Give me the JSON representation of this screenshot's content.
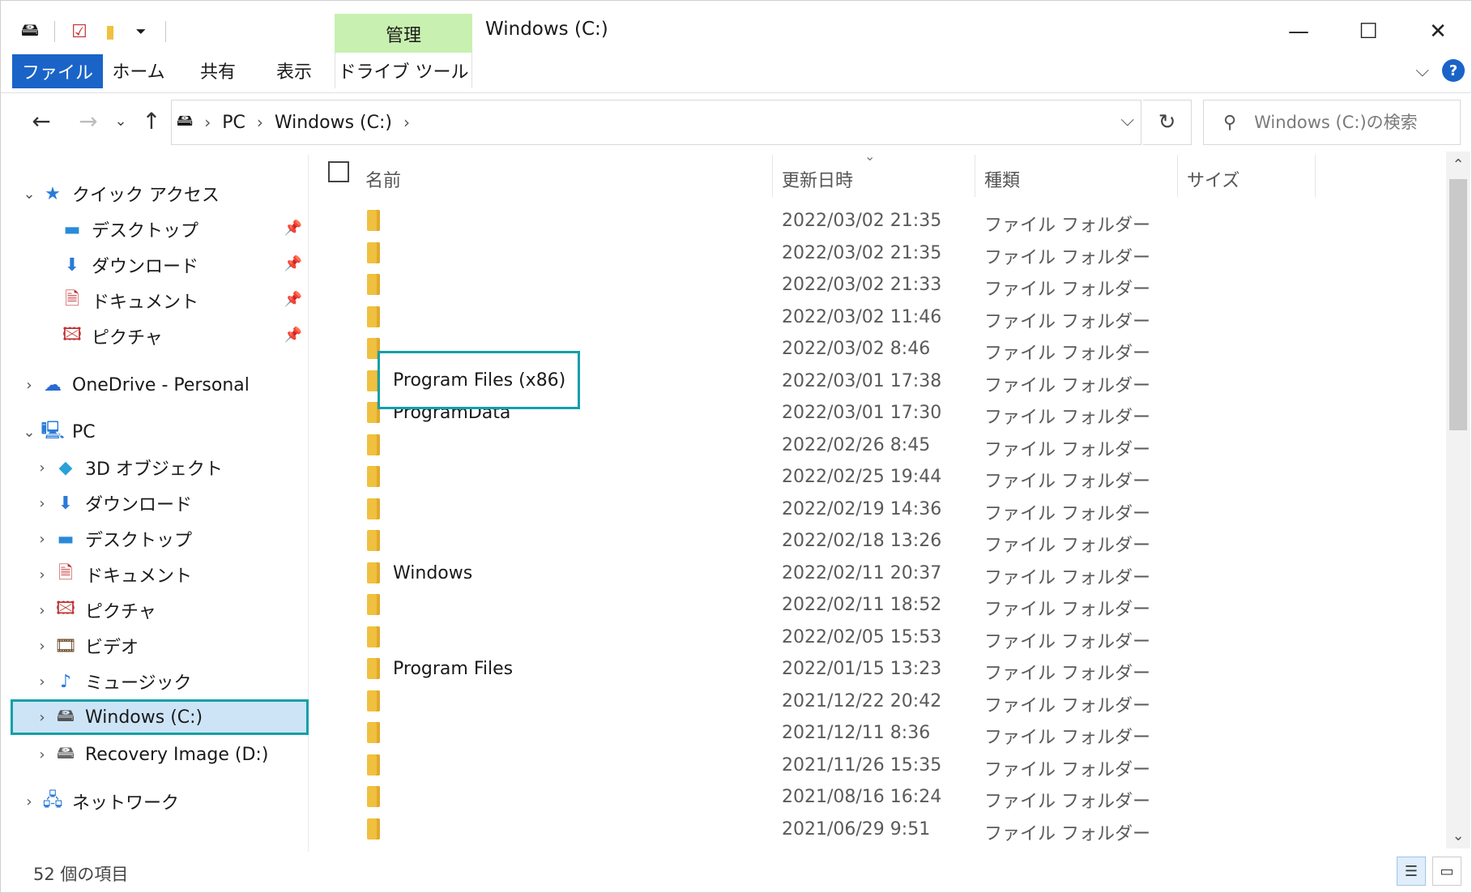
{
  "window": {
    "title": "Windows (C:)",
    "manage_tab": "管理",
    "controls": {
      "minimize": "—",
      "maximize": "☐",
      "close": "✕"
    }
  },
  "ribbon": {
    "tabs": {
      "file": "ファイル",
      "home": "ホーム",
      "share": "共有",
      "view": "表示",
      "drive_tools": "ドライブ ツール"
    },
    "help": "?"
  },
  "address": {
    "crumbs": [
      "PC",
      "Windows (C:)"
    ],
    "search_placeholder": "Windows (C:)の検索"
  },
  "nav": {
    "quick_access": "クイック アクセス",
    "qa_items": [
      "デスクトップ",
      "ダウンロード",
      "ドキュメント",
      "ピクチャ"
    ],
    "onedrive": "OneDrive - Personal",
    "pc": "PC",
    "pc_items": [
      "3D オブジェクト",
      "ダウンロード",
      "デスクトップ",
      "ドキュメント",
      "ピクチャ",
      "ビデオ",
      "ミュージック"
    ],
    "drive_c": "Windows (C:)",
    "drive_d": "Recovery Image (D:)",
    "network": "ネットワーク"
  },
  "columns": {
    "name": "名前",
    "date": "更新日時",
    "type": "種類",
    "size": "サイズ"
  },
  "rows": [
    {
      "name": "",
      "date": "2022/03/02 21:35",
      "type": "ファイル フォルダー"
    },
    {
      "name": "",
      "date": "2022/03/02 21:35",
      "type": "ファイル フォルダー"
    },
    {
      "name": "",
      "date": "2022/03/02 21:33",
      "type": "ファイル フォルダー"
    },
    {
      "name": "",
      "date": "2022/03/02 11:46",
      "type": "ファイル フォルダー"
    },
    {
      "name": "",
      "date": "2022/03/02 8:46",
      "type": "ファイル フォルダー"
    },
    {
      "name": "",
      "date": "2022/03/01 17:38",
      "type": "ファイル フォルダー"
    },
    {
      "name": "ProgramData",
      "date": "2022/03/01 17:30",
      "type": "ファイル フォルダー"
    },
    {
      "name": "",
      "date": "2022/02/26 8:45",
      "type": "ファイル フォルダー"
    },
    {
      "name": "",
      "date": "2022/02/25 19:44",
      "type": "ファイル フォルダー"
    },
    {
      "name": "",
      "date": "2022/02/19 14:36",
      "type": "ファイル フォルダー"
    },
    {
      "name": "",
      "date": "2022/02/18 13:26",
      "type": "ファイル フォルダー"
    },
    {
      "name": "Windows",
      "date": "2022/02/11 20:37",
      "type": "ファイル フォルダー"
    },
    {
      "name": "",
      "date": "2022/02/11 18:52",
      "type": "ファイル フォルダー"
    },
    {
      "name": "",
      "date": "2022/02/05 15:53",
      "type": "ファイル フォルダー"
    },
    {
      "name": "Program Files",
      "date": "2022/01/15 13:23",
      "type": "ファイル フォルダー"
    },
    {
      "name": "",
      "date": "2021/12/22 20:42",
      "type": "ファイル フォルダー"
    },
    {
      "name": "",
      "date": "2021/12/11 8:36",
      "type": "ファイル フォルダー"
    },
    {
      "name": "",
      "date": "2021/11/26 15:35",
      "type": "ファイル フォルダー"
    },
    {
      "name": "",
      "date": "2021/08/16 16:24",
      "type": "ファイル フォルダー"
    },
    {
      "name": "",
      "date": "2021/06/29 9:51",
      "type": "ファイル フォルダー"
    }
  ],
  "highlight": {
    "label": "Program Files (x86)"
  },
  "status": {
    "item_count": "52 個の項目"
  },
  "colors": {
    "accent": "#1a64c8",
    "highlight_border": "#14a0a8",
    "manage_tab": "#c8f0b0",
    "folder": "#f0c040"
  }
}
